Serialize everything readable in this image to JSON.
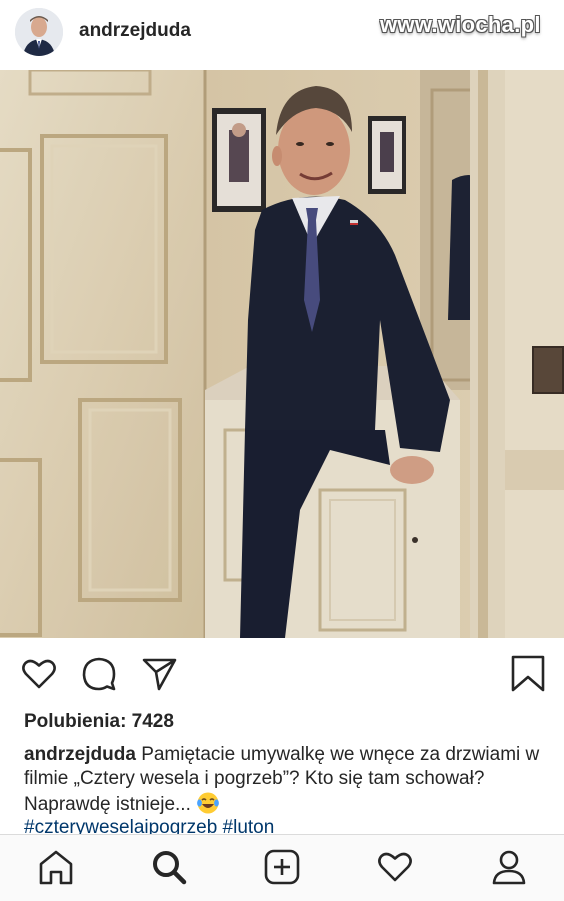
{
  "header": {
    "username": "andrzejduda",
    "watermark": "www.wiocha.pl"
  },
  "icons": {
    "avatar": "avatar",
    "like": "heart-icon",
    "comment": "comment-icon",
    "share": "paper-plane-icon",
    "save": "bookmark-icon",
    "home": "home-icon",
    "search": "search-icon",
    "new_post": "plus-square-icon",
    "activity": "heart-icon",
    "profile": "profile-icon",
    "emoji": "tears-of-joy-emoji"
  },
  "post": {
    "likes_label": "Polubienia: 7428",
    "caption_user": "andrzejduda",
    "caption_text": "Pamiętacie umywalkę we wnęce za drzwiami w filmie „Cztery wesela i pogrzeb”? Kto się tam schował? Naprawdę istnieje...",
    "hashtags": "#czteryweselaipogrzeb #luton"
  },
  "colors": {
    "text": "#262626",
    "hashtag": "#00376b",
    "nav_background": "#fafafa"
  }
}
